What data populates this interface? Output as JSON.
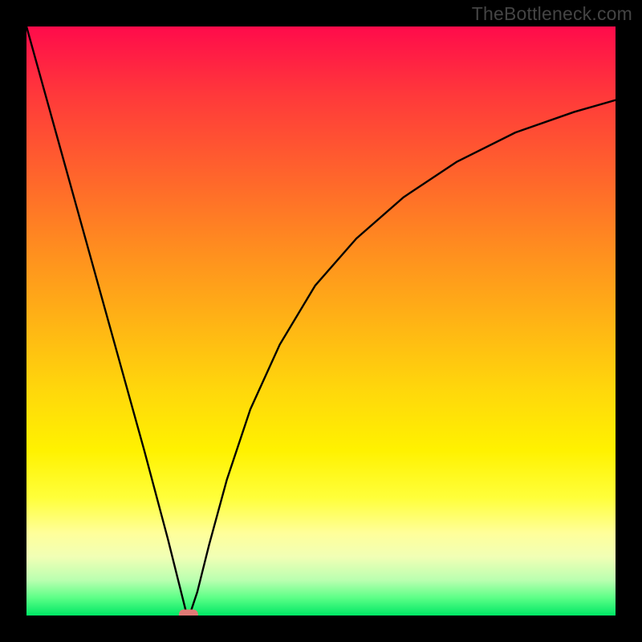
{
  "watermark": "TheBottleneck.com",
  "chart_data": {
    "type": "line",
    "title": "",
    "xlabel": "",
    "ylabel": "",
    "xlim": [
      0,
      100
    ],
    "ylim": [
      0,
      100
    ],
    "grid": false,
    "legend": false,
    "annotations": [],
    "marker": {
      "x": 27.5,
      "y": 0,
      "color": "#e07a76",
      "shape": "rounded-rect"
    },
    "series": [
      {
        "name": "curve",
        "x": [
          0,
          5,
          10,
          15,
          20,
          24,
          26,
          27,
          27.5,
          28,
          29,
          31,
          34,
          38,
          43,
          49,
          56,
          64,
          73,
          83,
          93,
          100
        ],
        "y": [
          100,
          82,
          64,
          46,
          28,
          13,
          5,
          1,
          0,
          1,
          4,
          12,
          23,
          35,
          46,
          56,
          64,
          71,
          77,
          82,
          85.5,
          87.5
        ]
      }
    ]
  }
}
